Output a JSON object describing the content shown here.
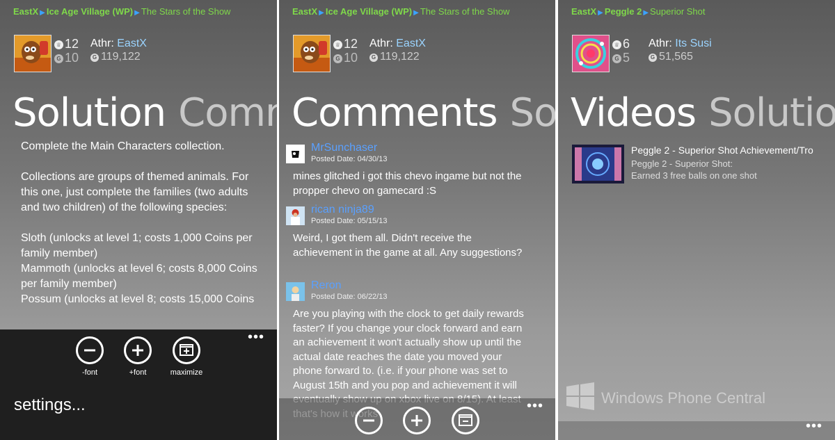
{
  "panels": [
    {
      "breadcrumb": {
        "author": "EastX",
        "game": "Ice Age Village (WP)",
        "title": "The Stars of the Show"
      },
      "stats": {
        "trophies": "12",
        "gamerscore_small": "10"
      },
      "author": {
        "label": "Athr:",
        "name": "EastX",
        "score": "119,122"
      },
      "pivot": {
        "active": "Solution",
        "next": "Comm"
      },
      "solution": {
        "p1": "Complete the Main Characters collection.",
        "p2": "Collections are groups of themed animals. For this one, just complete the families (two adults and two children) of the following species:",
        "l1": "Sloth (unlocks at level 1; costs 1,000 Coins per family member)",
        "l2": "Mammoth (unlocks at level 6; costs 8,000 Coins per family member)",
        "l3": "Possum (unlocks at level 8; costs 15,000 Coins"
      },
      "appbar": {
        "minus_font": "-font",
        "plus_font": "+font",
        "maximize": "maximize",
        "settings": "settings...",
        "more": "•••"
      }
    },
    {
      "breadcrumb": {
        "author": "EastX",
        "game": "Ice Age Village (WP)",
        "title": "The Stars of the Show"
      },
      "stats": {
        "trophies": "12",
        "gamerscore_small": "10"
      },
      "author": {
        "label": "Athr:",
        "name": "EastX",
        "score": "119,122"
      },
      "pivot": {
        "active": "Comments",
        "next": "Solu"
      },
      "comments": [
        {
          "user": "MrSunchaser",
          "date": "Posted Date: 04/30/13",
          "body": "mines glitched i got this chevo ingame but not the propper chevo on gamecard :S"
        },
        {
          "user": "rican ninja89",
          "date": "Posted Date: 05/15/13",
          "body": "Weird, I got them all. Didn't receive the achievement in the game at all. Any suggestions?"
        },
        {
          "user": "Reron",
          "date": "Posted Date: 06/22/13",
          "body": "Are you playing with the clock to get daily rewards faster?  If you change your clock forward and earn an achievement it won't actually show up until the actual date reaches the date you moved your phone forward to. (i.e. if your phone was set to August 15th and you pop and achievement it will eventually show up on xbox live on 8/15). At least that's how it works"
        }
      ],
      "more": "•••"
    },
    {
      "breadcrumb": {
        "author": "EastX",
        "game": "Peggle 2",
        "title": "Superior Shot"
      },
      "stats": {
        "trophies": "6",
        "gamerscore_small": "5"
      },
      "author": {
        "label": "Athr:",
        "name": "Its Susi",
        "score": "51,565"
      },
      "pivot": {
        "active": "Videos",
        "next": "Solution"
      },
      "video": {
        "title": "Peggle 2 - Superior Shot Achievement/Tro",
        "sub1": "Peggle 2 - Superior Shot:",
        "sub2": "Earned 3 free balls on one shot"
      },
      "watermark": "Windows Phone Central",
      "more": "•••"
    }
  ],
  "colors": {
    "breadcrumb": "#7fd84a",
    "link": "#5aa0ff",
    "appbar": "#1f1f1f"
  }
}
